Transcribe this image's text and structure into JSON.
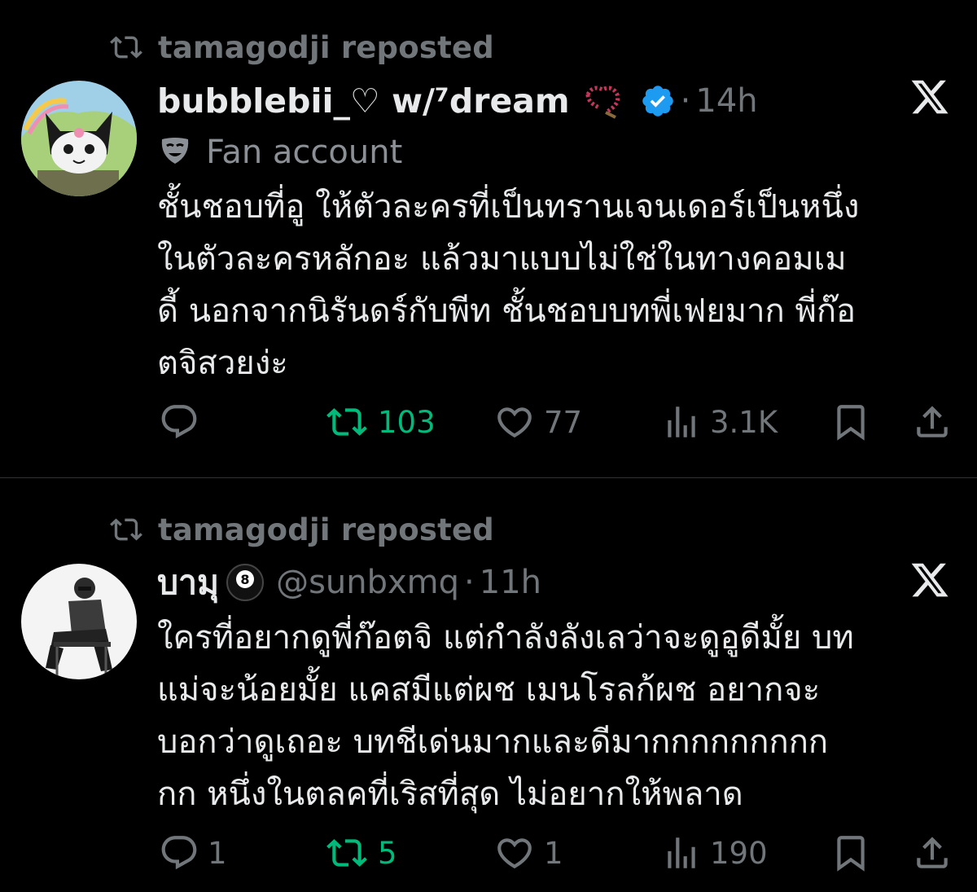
{
  "posts": [
    {
      "repost_text": "tamagodji reposted",
      "display_name": "bubblebii_♡ w/⁷dream",
      "handle": "",
      "time": "14h",
      "label": "Fan account",
      "body_lines": [
        "ชั้นชอบที่อู ให้ตัวละครที่เป็นทรานเจนเดอร์เป็นหนึ่ง",
        "ในตัวละครหลักอะ แล้วมาแบบไม่ใช่ในทางคอมเม",
        "ดี้ นอกจากนิรันดร์กับพีท ชั้นชอบบทพี่เฟยมาก พี่ก๊อ",
        "ตจิสวยง่ะ"
      ],
      "replies": "",
      "reposts": "103",
      "likes": "77",
      "views": "3.1K",
      "accent": "#00ba7c",
      "verified_color": "#1d9bf0"
    },
    {
      "repost_text": "tamagodji reposted",
      "display_name": "บามุ",
      "handle": "@sunbxmq",
      "time": "11h",
      "label": "",
      "body_lines": [
        "ใครที่อยากดูพี่ก๊อตจิ แต่กำลังลังเลว่าจะดูอูดีมั้ย บท",
        "แม่จะน้อยมั้ย แคสมีแต่ผช เมนโรลก้ผช อยากจะ",
        "บอกว่าดูเถอะ บทชีเด่นมากและดีมากกกกกกกกก",
        "กก หนึ่งในตลคที่เริสที่สุด ไม่อยากให้พลาด"
      ],
      "replies": "1",
      "reposts": "5",
      "likes": "1",
      "views": "190",
      "accent": "#00ba7c"
    }
  ],
  "icons": [
    "repost-icon",
    "x-logo-icon",
    "verified-badge-icon",
    "fan-mask-icon",
    "reply-icon",
    "like-icon",
    "views-icon",
    "bookmark-icon",
    "share-icon",
    "rosary-emoji-icon",
    "eight-ball-emoji-icon"
  ]
}
